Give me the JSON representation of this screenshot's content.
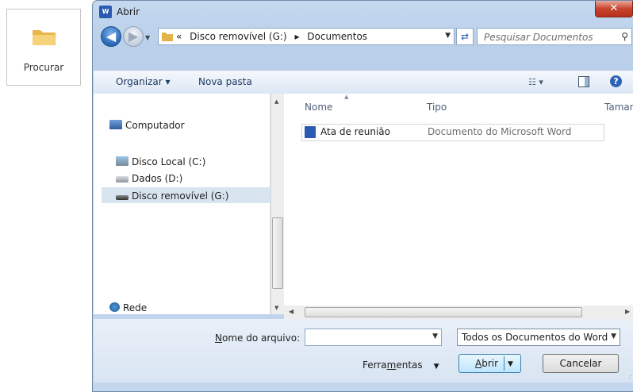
{
  "procurar": {
    "label": "Procurar"
  },
  "window": {
    "title": "Abrir",
    "close_glyph": "✕"
  },
  "address": {
    "overflow": "«",
    "crumbs": [
      "Disco removível (G:)",
      "Documentos"
    ],
    "separator": "▸"
  },
  "search": {
    "placeholder": "Pesquisar Documentos"
  },
  "toolbar": {
    "organize": "Organizar ▾",
    "new_folder": "Nova pasta"
  },
  "nav": {
    "computer": "Computador",
    "drives": [
      "Disco Local (C:)",
      "Dados (D:)",
      "Disco removível (G:)"
    ],
    "network": "Rede",
    "selected": "Disco removível (G:)"
  },
  "columns": {
    "name": "Nome",
    "type": "Tipo",
    "size": "Taman"
  },
  "files": [
    {
      "name": "Ata de reunião",
      "type": "Documento do Microsoft Word"
    }
  ],
  "bottom": {
    "filename_label_pre": "",
    "filename_label_accel": "N",
    "filename_label_post": "ome do arquivo:",
    "filename_value": "",
    "filetype": "Todos os Documentos do Word",
    "tools_pre": "Ferra",
    "tools_accel": "m",
    "tools_post": "entas",
    "open_pre": "",
    "open_accel": "A",
    "open_post": "brir",
    "cancel": "Cancelar"
  },
  "colors": {
    "title_bg": "#c5d9ef",
    "close_red": "#c7442e",
    "selection": "#d9e4f1"
  }
}
